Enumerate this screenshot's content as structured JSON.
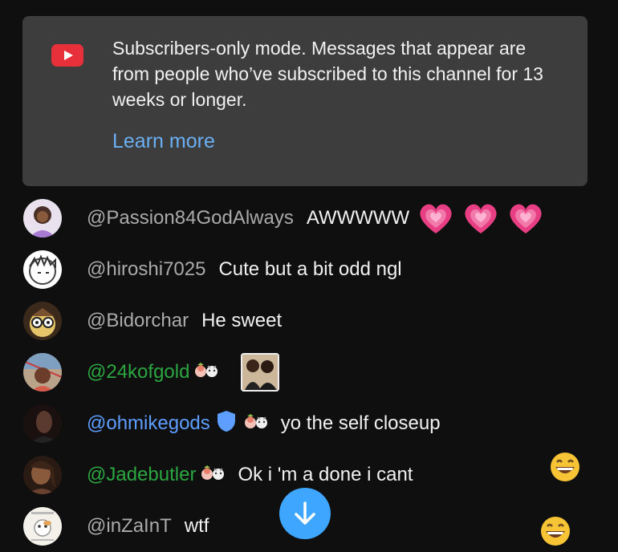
{
  "banner": {
    "icon": "youtube-icon",
    "message": "Subscribers-only mode. Messages that appear are from people who’ve subscribed to this channel for 13 weeks or longer.",
    "learn_more": "Learn more",
    "colors": {
      "background": "#3d3d3d",
      "link": "#6ab0f3",
      "logo": "#e8303a"
    }
  },
  "messages": [
    {
      "author": "@Passion84GodAlways",
      "text": "AWWWWW",
      "emoji": [
        "heart-icon",
        "heart-icon",
        "heart-icon"
      ]
    },
    {
      "author": "@hiroshi7025",
      "text": "Cute but a bit odd ngl"
    },
    {
      "author": "@Bidorchar",
      "text": "He sweet"
    },
    {
      "author": "@24kofgold",
      "text": "",
      "sticker": "photo-sticker",
      "member": true
    },
    {
      "author": "@ohmikegods",
      "text": "yo the self closeup",
      "moderator": true
    },
    {
      "author": "@Jadebutler",
      "text": "Ok i 'm a done i cant",
      "member": true,
      "reaction": "grinning-face-icon"
    },
    {
      "author": "@inZaInT",
      "text": "wtf",
      "reaction": "grinning-face-icon"
    }
  ],
  "scroll_button": {
    "icon": "arrow-down-icon",
    "color": "#3ea6ff"
  },
  "colors": {
    "author": "#aaaaaa",
    "member": "#2ba640",
    "moderator": "#5e9eff",
    "text": "#f1f1f1",
    "page": "#0f0f0f"
  }
}
